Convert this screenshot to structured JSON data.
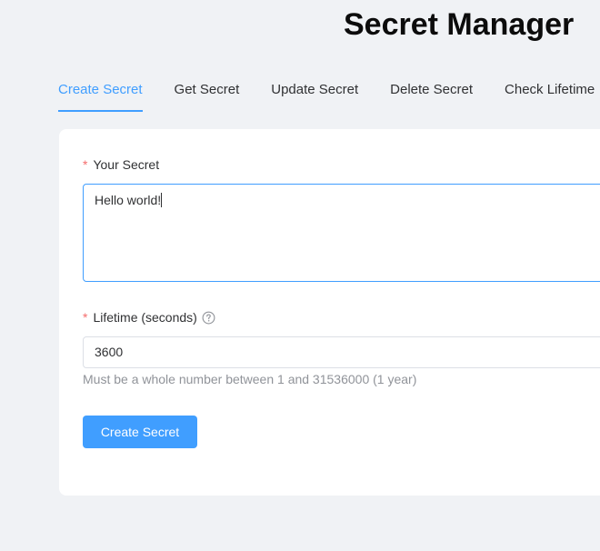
{
  "header": {
    "title": "Secret Manager"
  },
  "tabs": [
    {
      "label": "Create Secret",
      "active": true
    },
    {
      "label": "Get Secret",
      "active": false
    },
    {
      "label": "Update Secret",
      "active": false
    },
    {
      "label": "Delete Secret",
      "active": false
    },
    {
      "label": "Check Lifetime",
      "active": false
    }
  ],
  "form": {
    "secret": {
      "required_mark": "*",
      "label": "Your Secret",
      "value": "Hello world!"
    },
    "lifetime": {
      "required_mark": "*",
      "label": "Lifetime (seconds)",
      "help_icon": "question-circle-icon",
      "value": "3600",
      "hint": "Must be a whole number between 1 and 31536000 (1 year)"
    },
    "submit_label": "Create Secret"
  },
  "colors": {
    "accent": "#409eff",
    "required": "#f56c6c",
    "background": "#f0f2f5",
    "card": "#ffffff",
    "hint": "#909399"
  }
}
